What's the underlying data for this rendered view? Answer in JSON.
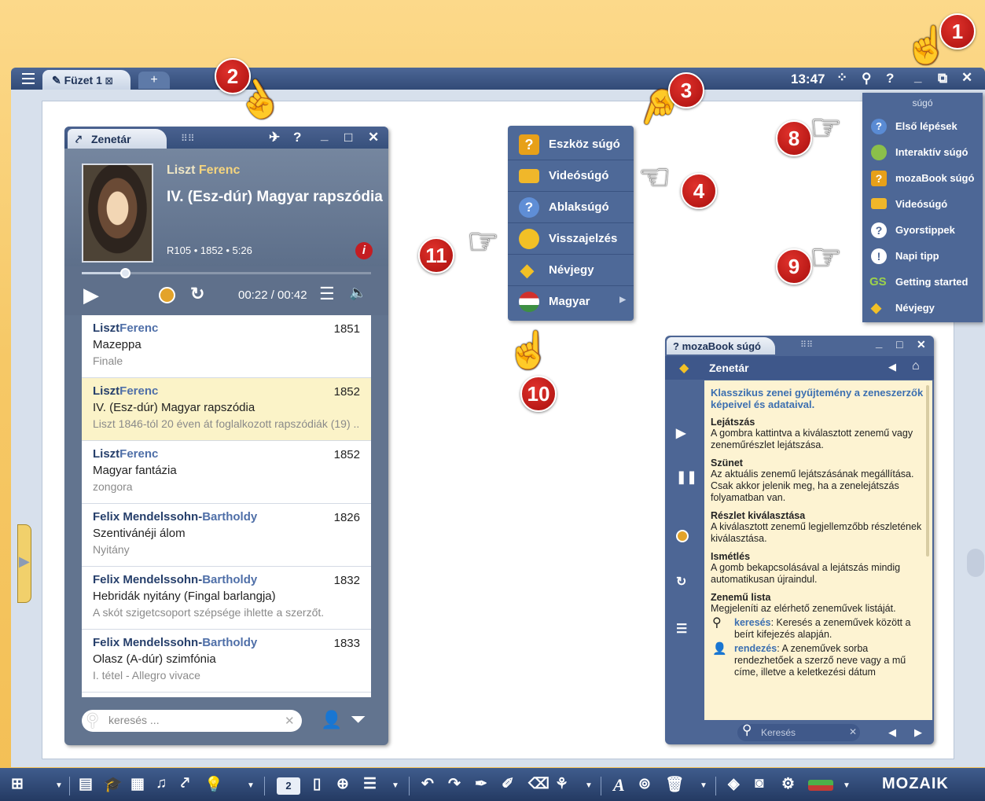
{
  "topbar": {
    "tab_label": "Füzet 1",
    "tab_close": "☒",
    "add_tab": "+",
    "time": "13:47"
  },
  "zenetar": {
    "title": "Zenetár",
    "composer_first": "Liszt",
    "composer_last": "Ferenc",
    "piece": "IV. (Esz-dúr) Magyar rapszódia",
    "meta": "R105 • 1852 • 5:26",
    "time": "00:22 / 00:42",
    "progress": 0.15,
    "list": [
      {
        "first": "Liszt",
        "last": "Ferenc",
        "year": "1851",
        "title": "Mazeppa",
        "sub": "Finale",
        "selected": false
      },
      {
        "first": "Liszt",
        "last": "Ferenc",
        "year": "1852",
        "title": "IV. (Esz-dúr) Magyar rapszódia",
        "sub": "Liszt 1846-tól 20 éven át foglalkozott rapszódiák (19) ..",
        "selected": true
      },
      {
        "first": "Liszt",
        "last": "Ferenc",
        "year": "1852",
        "title": "Magyar fantázia",
        "sub": "zongora",
        "selected": false
      },
      {
        "first": "Felix Mendelssohn-",
        "last": "Bartholdy",
        "year": "1826",
        "title": "Szentivánéji álom",
        "sub": "Nyitány",
        "selected": false
      },
      {
        "first": "Felix Mendelssohn-",
        "last": "Bartholdy",
        "year": "1832",
        "title": "Hebridák nyitány (Fingal barlangja)",
        "sub": "A skót szigetcsoport szépsége ihlette a szerzőt.",
        "selected": false
      },
      {
        "first": "Felix Mendelssohn-",
        "last": "Bartholdy",
        "year": "1833",
        "title": "Olasz (A-dúr) szimfónia",
        "sub": "I. tétel - Allegro vivace",
        "selected": false
      }
    ],
    "search_placeholder": "keresés ..."
  },
  "help_menu": {
    "items": [
      "Eszköz súgó",
      "Videósúgó",
      "Ablaksúgó",
      "Visszajelzés",
      "Névjegy",
      "Magyar"
    ]
  },
  "sugo_menu": {
    "title": "súgó",
    "items": [
      "Első lépések",
      "Interaktív súgó",
      "mozaBook súgó",
      "Videósúgó",
      "Gyorstippek",
      "Napi tipp",
      "Getting started",
      "Névjegy"
    ]
  },
  "moza_help": {
    "title": "mozaBook súgó",
    "section": "Zenetár",
    "intro": "Klasszikus zenei gyűjtemény a zeneszerzők képeivel és adataival.",
    "entries": [
      {
        "h": "Lejátszás",
        "p": "A gombra kattintva a kiválasztott zenemű vagy zeneműrészlet lejátszása."
      },
      {
        "h": "Szünet",
        "p": "Az aktuális zenemű lejátszásának megállítása. Csak akkor jelenik meg, ha a zenelejátszás folyamatban van."
      },
      {
        "h": "Részlet kiválasztása",
        "p": "A kiválasztott zenemű legjellemzőbb részletének kiválasztása."
      },
      {
        "h": "Ismétlés",
        "p": "A gomb bekapcsolásával a lejátszás mindig automatikusan újraindul."
      },
      {
        "h": "Zenemű lista",
        "p": "Megjeleníti az elérhető zeneművek listáját."
      }
    ],
    "search_key": "keresés",
    "search_text": ": Keresés a zeneművek között a beírt kifejezés alapján.",
    "sort_key": "rendezés",
    "sort_text": ": A zeneművek sorba rendezhetőek a szerző neve vagy a mű címe, illetve a keletkezési dátum",
    "search_placeholder": "Keresés"
  },
  "callouts": [
    "1",
    "2",
    "3",
    "4",
    "8",
    "9",
    "10",
    "11"
  ],
  "bottom": {
    "page": "2",
    "logo": "MOZAIK"
  }
}
